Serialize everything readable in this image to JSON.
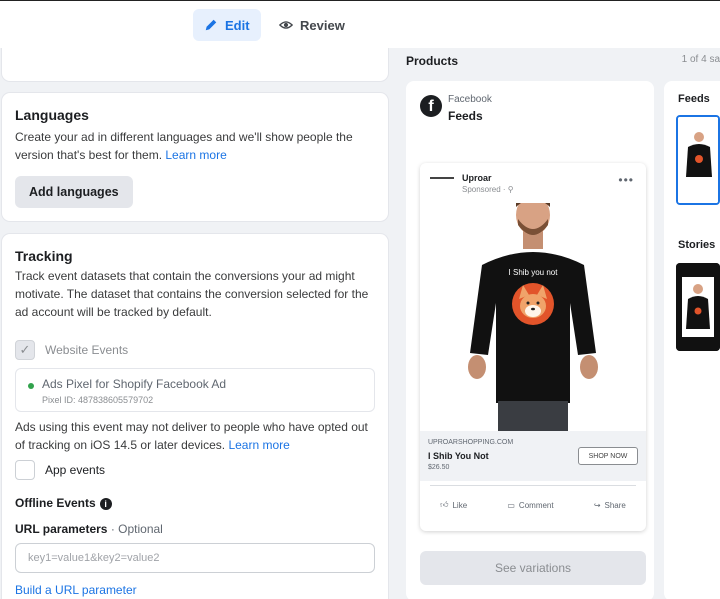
{
  "header": {
    "edit_label": "Edit",
    "review_label": "Review"
  },
  "languages": {
    "title": "Languages",
    "description": "Create your ad in different languages and we'll show people the version that's best for them.",
    "learn_more": "Learn more",
    "add_button": "Add languages"
  },
  "tracking": {
    "title": "Tracking",
    "description": "Track event datasets that contain the conversions your ad might motivate. The dataset that contains the conversion selected for the ad account will be tracked by default.",
    "website_events_label": "Website Events",
    "pixel_name": "Ads Pixel for Shopify Facebook Ad",
    "pixel_id": "Pixel ID: 487838605579702",
    "ios_note": "Ads using this event may not deliver to people who have opted out of tracking on iOS 14.5 or later devices.",
    "learn_more": "Learn more",
    "app_events_label": "App events",
    "offline_events_label": "Offline Events",
    "url_params_label": "URL parameters",
    "optional_label": " · Optional",
    "url_params_placeholder": "key1=value1&key2=value2",
    "build_url_link": "Build a URL parameter"
  },
  "preview": {
    "products_label": "Products",
    "pager_text": "1 of 4 sa",
    "platform": "Facebook",
    "placement": "Feeds",
    "ad": {
      "page_name": "Uproar",
      "sponsored": "Sponsored · ⚲",
      "shirt_text": "I Shib you not",
      "domain": "UPROARSHOPPING.COM",
      "product_title": "I Shib You Not",
      "price": "$26.50",
      "cta": "SHOP NOW",
      "like": "Like",
      "comment": "Comment",
      "share": "Share"
    },
    "variations_button": "See variations",
    "side_feeds_label": "Feeds",
    "side_stories_label": "Stories"
  },
  "colors": {
    "accent": "#1b74e4",
    "pixel_status": "#31a24c",
    "shirt": "#111111",
    "shiba": "#e2542a"
  }
}
